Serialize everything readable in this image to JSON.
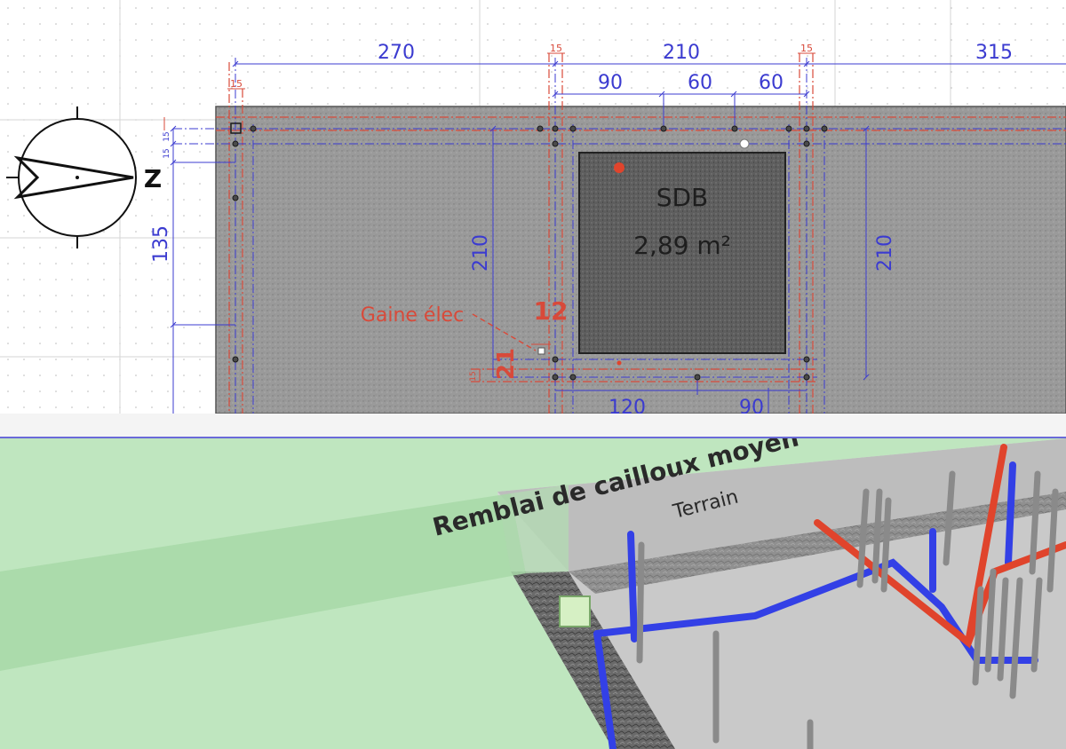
{
  "plan": {
    "dims_top": {
      "d270": "270",
      "d210": "210",
      "d315": "315",
      "d15_a": "15",
      "d15_b": "15",
      "d15_c": "15"
    },
    "dims_second": {
      "d90": "90",
      "d60_a": "60",
      "d60_b": "60"
    },
    "dims_left": {
      "d135": "135",
      "d15_v1": "15",
      "d15_v2": "15"
    },
    "dims_inner": {
      "d210_left": "210",
      "d210_right": "210",
      "d120": "120",
      "d90_bottom": "90",
      "d12": "12",
      "d21": "21",
      "d15_small": "15"
    },
    "room": {
      "name": "SDB",
      "area": "2,89 m²"
    },
    "annotation": {
      "gaine": "Gaine élec"
    },
    "compass": {
      "letter": "Z"
    },
    "colors": {
      "dim": "#3b3bd0",
      "ref": "#d84a3a",
      "slab": "#8c8c8c",
      "room": "#5b5b5b"
    }
  },
  "view3d": {
    "labels": {
      "remblai": "Remblai de cailloux moyen",
      "terrain": "Terrain"
    },
    "colors": {
      "ground": "#b8e0b8",
      "pipe_blue": "#3340e6",
      "pipe_red": "#e0442c",
      "post": "#8a8a8a"
    }
  }
}
